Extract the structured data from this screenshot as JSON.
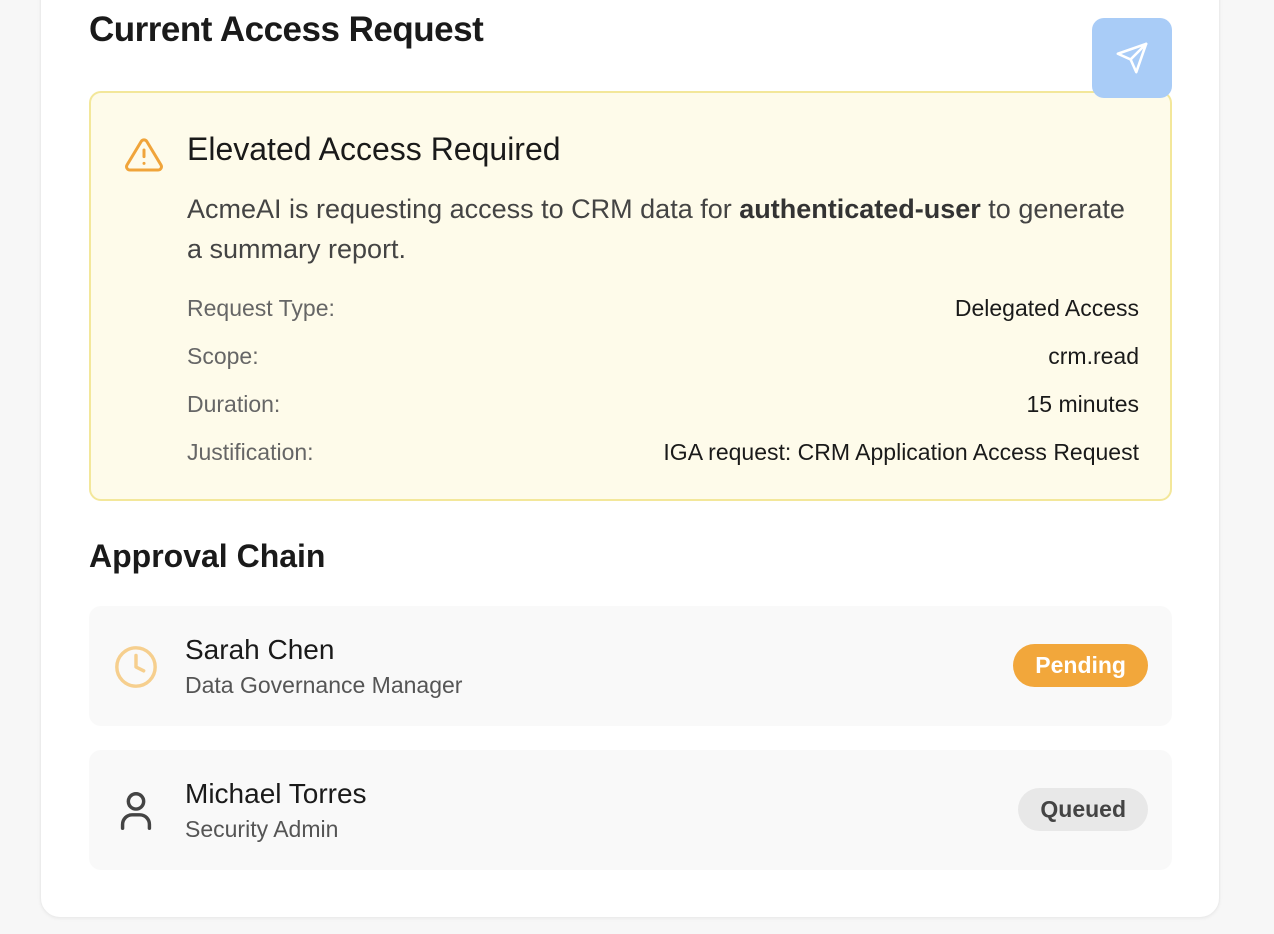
{
  "page": {
    "title": "Current Access Request",
    "send_icon": "send-icon"
  },
  "alert": {
    "icon": "warning-triangle-icon",
    "title": "Elevated Access Required",
    "desc_prefix": "AcmeAI is requesting access to CRM data for ",
    "desc_user": "authenticated-user",
    "desc_suffix": " to generate a summary report.",
    "details": [
      {
        "label": "Request Type:",
        "value": "Delegated Access"
      },
      {
        "label": "Scope:",
        "value": "crm.read"
      },
      {
        "label": "Duration:",
        "value": "15 minutes"
      },
      {
        "label": "Justification:",
        "value": "IGA request: CRM Application Access Request"
      }
    ],
    "colors": {
      "background": "#fefbea",
      "border": "#f3e79a",
      "icon": "#f0a43a"
    }
  },
  "approval_chain": {
    "title": "Approval Chain",
    "approvers": [
      {
        "name": "Sarah Chen",
        "role": "Data Governance Manager",
        "status": "Pending",
        "icon": "clock-icon"
      },
      {
        "name": "Michael Torres",
        "role": "Security Admin",
        "status": "Queued",
        "icon": "user-icon"
      }
    ]
  },
  "colors": {
    "send_button": "#a9ccf7",
    "pending_badge": "#f2a73b",
    "queued_badge": "#e8e8e8"
  }
}
